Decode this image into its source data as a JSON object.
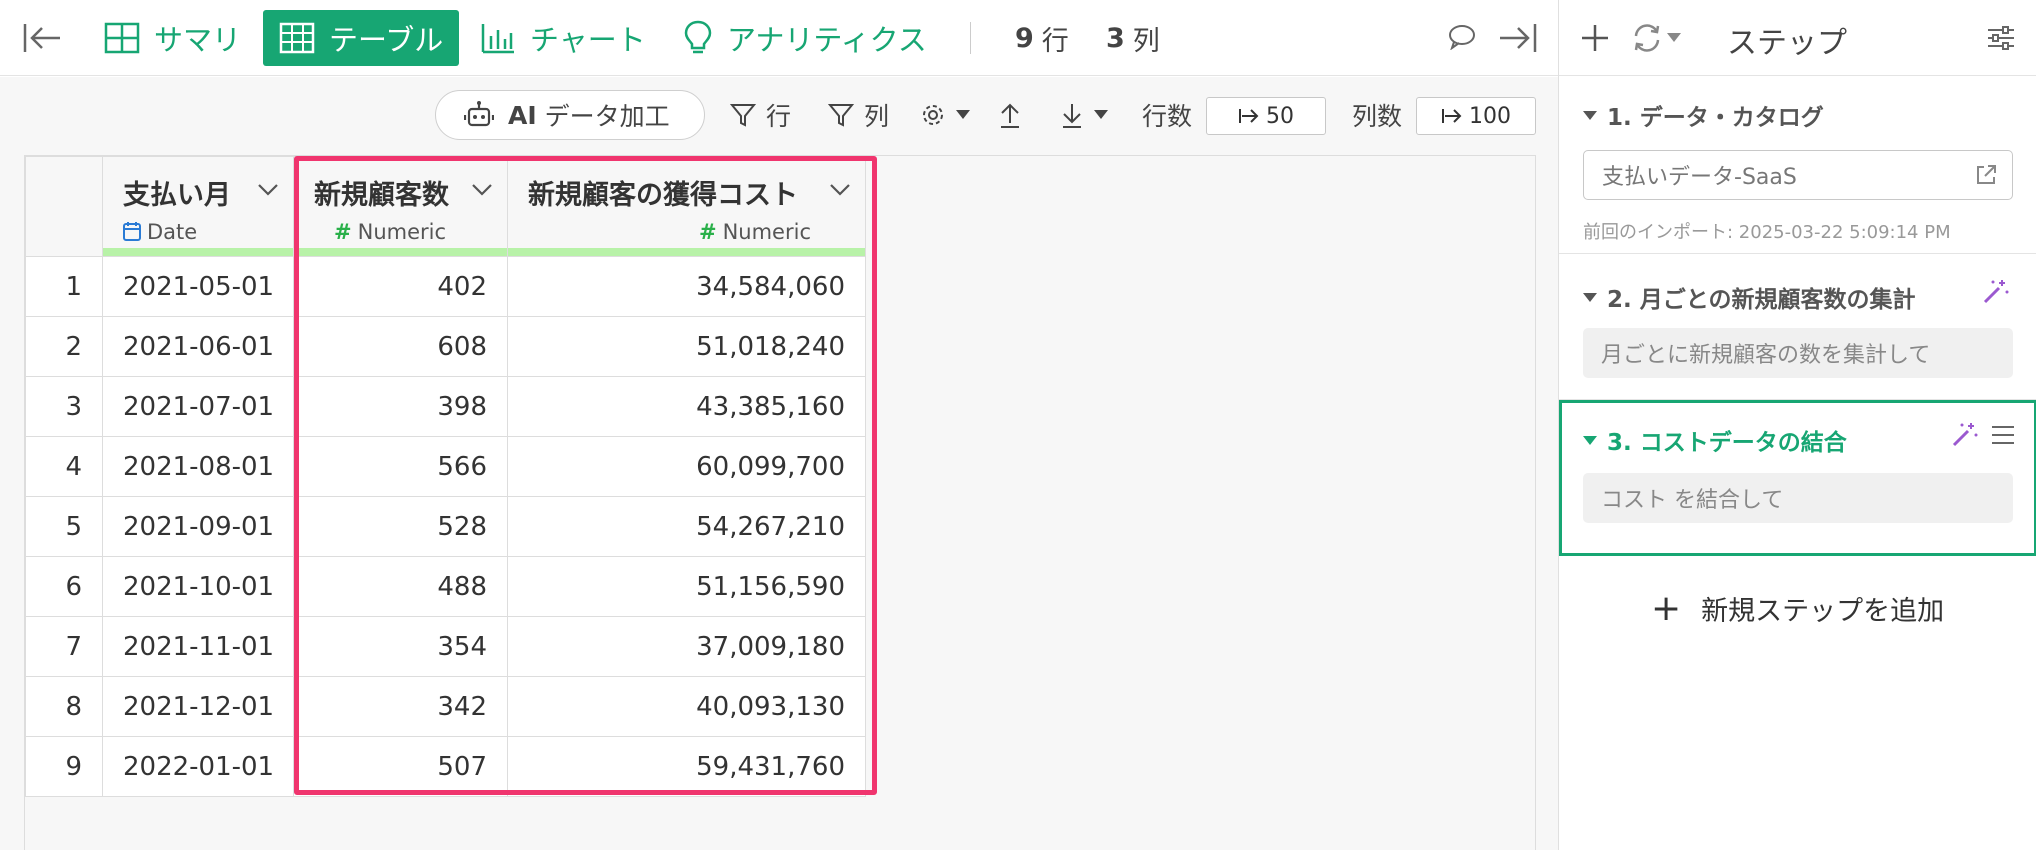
{
  "toolbar": {
    "summary_label": "サマリ",
    "table_label": "テーブル",
    "chart_label": "チャート",
    "analytics_label": "アナリティクス",
    "rows_count": "9",
    "rows_unit": "行",
    "cols_count": "3",
    "cols_unit": "列"
  },
  "subbar": {
    "ai_prefix": "AI",
    "ai_label": "データ加工",
    "row_filter_label": "行",
    "col_filter_label": "列",
    "row_count_label": "行数",
    "row_count_value": "50",
    "col_count_label": "列数",
    "col_count_value": "100"
  },
  "table": {
    "columns": [
      {
        "name": "支払い月",
        "type": "Date"
      },
      {
        "name": "新規顧客数",
        "type": "Numeric"
      },
      {
        "name": "新規顧客の獲得コスト",
        "type": "Numeric"
      }
    ],
    "rows": [
      {
        "n": "1",
        "month": "2021-05-01",
        "customers": "402",
        "cost": "34,584,060"
      },
      {
        "n": "2",
        "month": "2021-06-01",
        "customers": "608",
        "cost": "51,018,240"
      },
      {
        "n": "3",
        "month": "2021-07-01",
        "customers": "398",
        "cost": "43,385,160"
      },
      {
        "n": "4",
        "month": "2021-08-01",
        "customers": "566",
        "cost": "60,099,700"
      },
      {
        "n": "5",
        "month": "2021-09-01",
        "customers": "528",
        "cost": "54,267,210"
      },
      {
        "n": "6",
        "month": "2021-10-01",
        "customers": "488",
        "cost": "51,156,590"
      },
      {
        "n": "7",
        "month": "2021-11-01",
        "customers": "354",
        "cost": "37,009,180"
      },
      {
        "n": "8",
        "month": "2021-12-01",
        "customers": "342",
        "cost": "40,093,130"
      },
      {
        "n": "9",
        "month": "2022-01-01",
        "customers": "507",
        "cost": "59,431,760"
      }
    ]
  },
  "panel": {
    "title": "ステップ",
    "steps": [
      {
        "title": "1. データ・カタログ",
        "box": "支払いデータ-SaaS",
        "note": "前回のインポート: 2025-03-22 5:09:14 PM"
      },
      {
        "title": "2. 月ごとの新規顧客数の集計",
        "box": "月ごとに新規顧客の数を集計して"
      },
      {
        "title": "3. コストデータの結合",
        "box": "コスト を結合して"
      }
    ],
    "add_step_label": "新規ステップを追加"
  },
  "colors": {
    "accent": "#17a673",
    "highlight": "#f0356e",
    "column_bar": "#b8f2a8",
    "magic_wand": "#9b59d0"
  }
}
